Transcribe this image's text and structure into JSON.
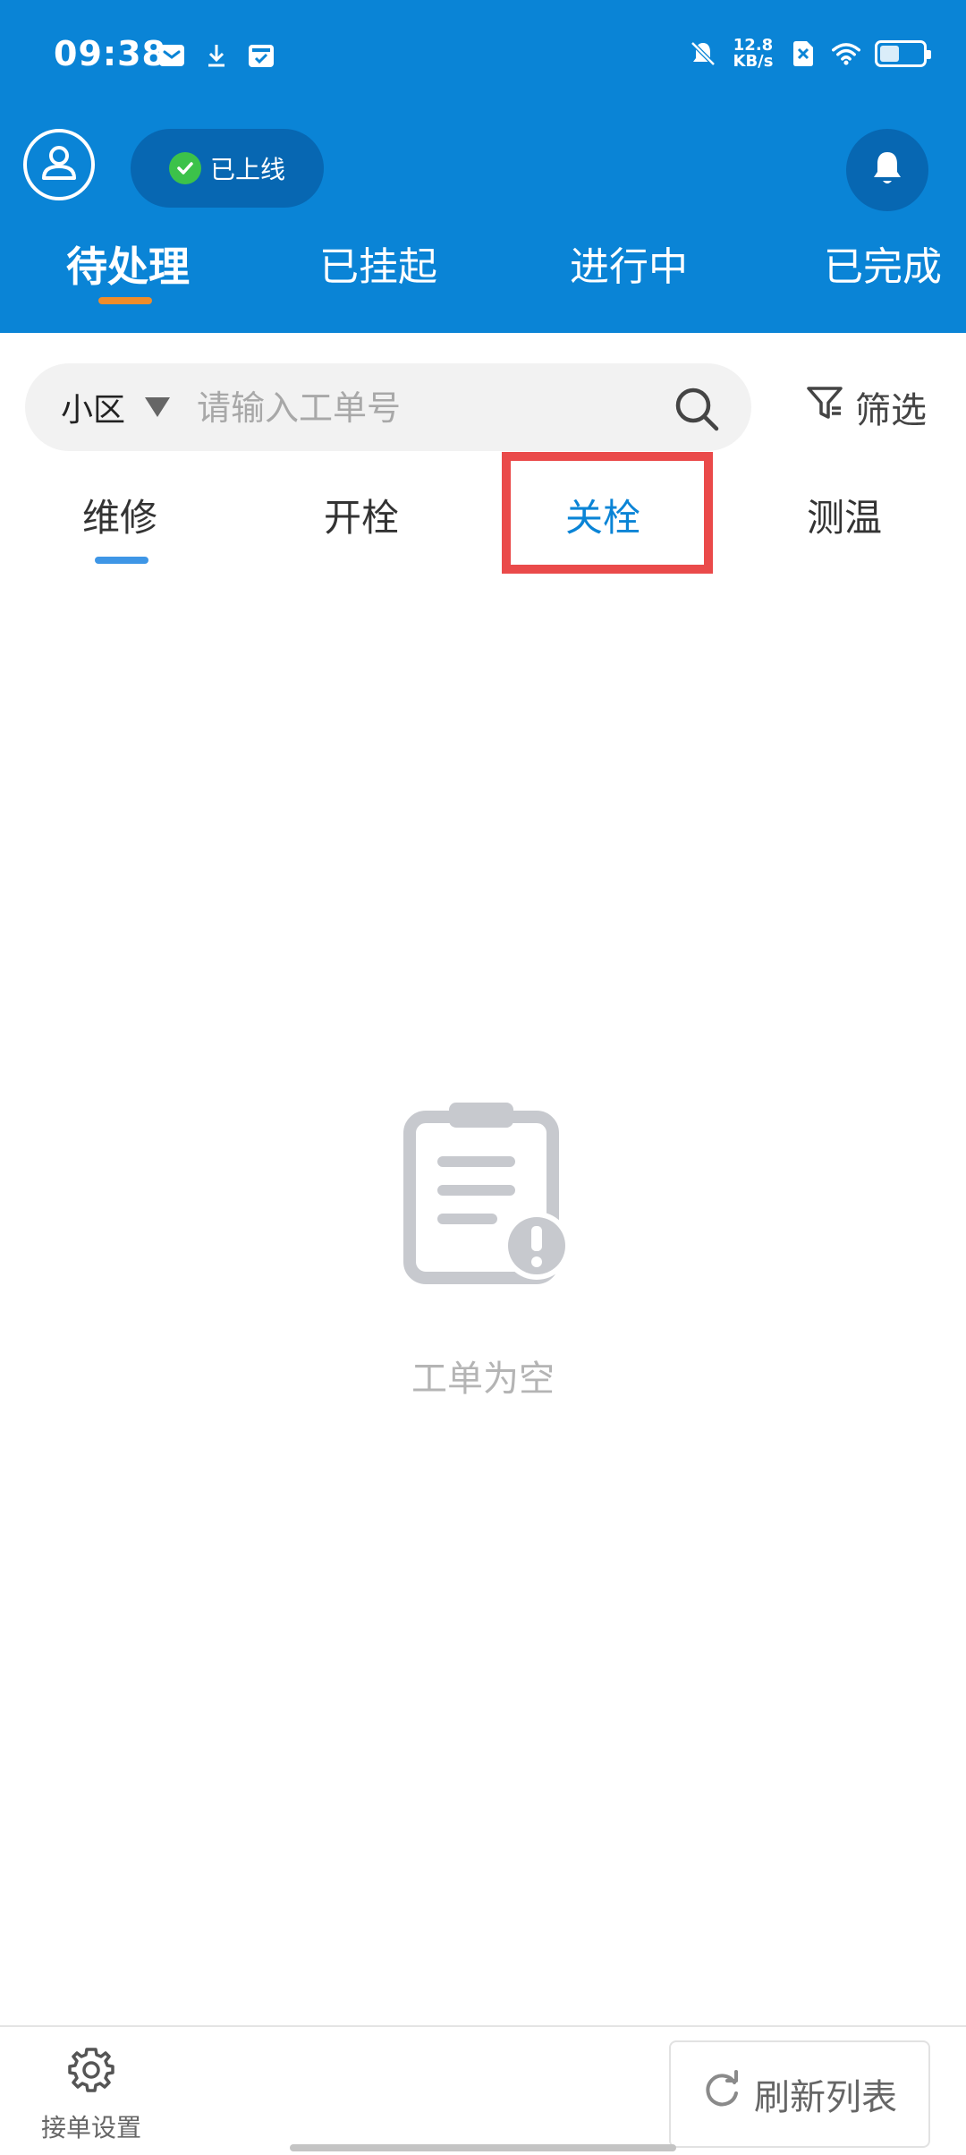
{
  "status_bar": {
    "time": "09:38",
    "net_speed_value": "12.8",
    "net_speed_unit": "KB/s"
  },
  "header": {
    "online_status": "已上线",
    "status_tabs": [
      {
        "label": "待处理"
      },
      {
        "label": "已挂起"
      },
      {
        "label": "进行中"
      },
      {
        "label": "已完成"
      }
    ],
    "active_status_tab": "待处理"
  },
  "search": {
    "area_label": "小区",
    "placeholder": "请输入工单号",
    "filter_label": "筛选"
  },
  "category_tabs": [
    {
      "label": "维修"
    },
    {
      "label": "开栓"
    },
    {
      "label": "关栓"
    },
    {
      "label": "测温"
    }
  ],
  "empty_state": {
    "message": "工单为空"
  },
  "bottom_bar": {
    "settings_label": "接单设置",
    "refresh_label": "刷新列表"
  },
  "status": {
    "battery_level": 0.45
  },
  "colors": {
    "header_bg": "#0a84d6",
    "active_tab_indicator": "#f08c2a",
    "category_active": "#0a84d6",
    "highlight": "#ea4a4a",
    "online_dot": "#3cc24a"
  },
  "icons": {
    "mail": "mail-icon",
    "download": "download-icon",
    "calendar": "calendar-icon",
    "mute": "bell-off-icon",
    "sim": "sim-x-icon",
    "wifi": "wifi-icon",
    "battery": "battery-icon",
    "avatar": "user-icon",
    "bell": "bell-icon",
    "search": "search-icon",
    "filter": "filter-icon",
    "empty": "clipboard-alert-icon",
    "settings": "gear-icon",
    "refresh": "refresh-icon"
  }
}
